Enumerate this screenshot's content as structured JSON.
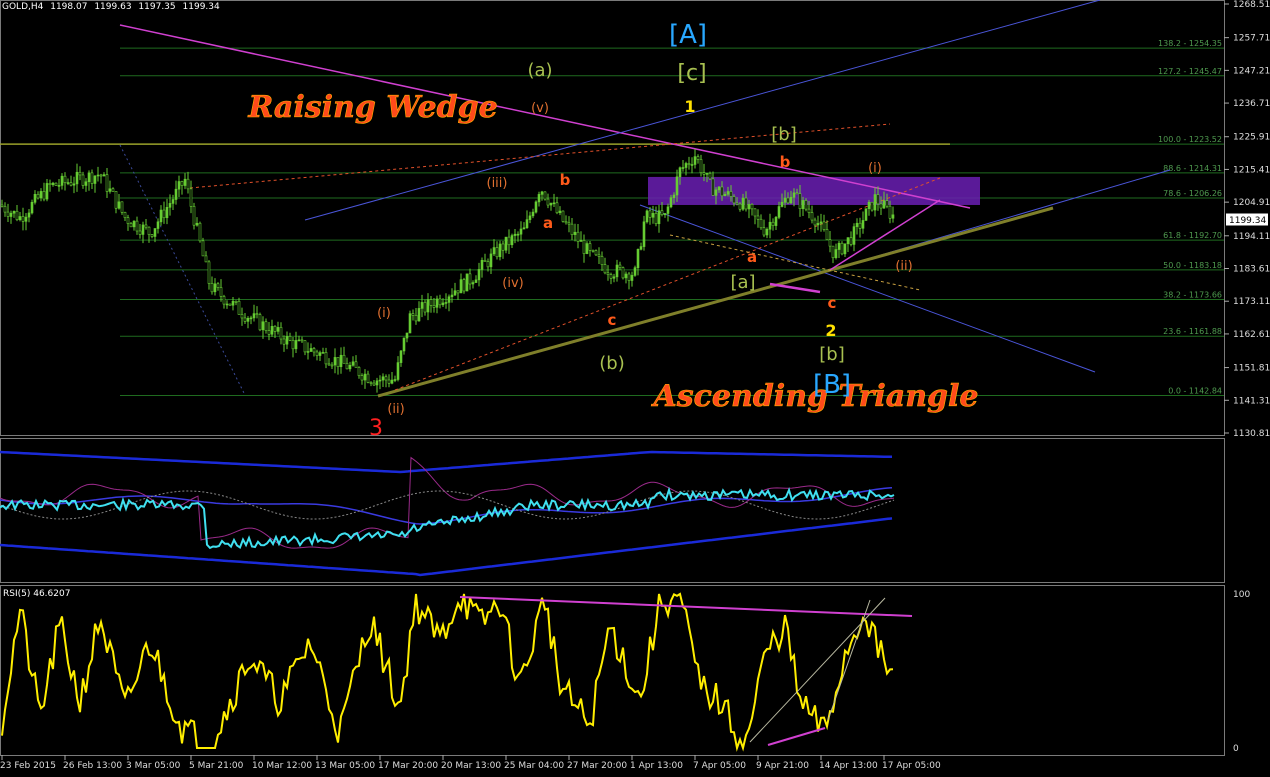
{
  "header": {
    "symbol": "GOLD,H4",
    "open": "1198.07",
    "high": "1199.63",
    "low": "1197.35",
    "close": "1199.34"
  },
  "current_price": "1199.34",
  "rsi_label": "RSI(5) 46.6207",
  "price_axis": [
    "1268.51",
    "1257.71",
    "1247.21",
    "1236.71",
    "1225.91",
    "1215.41",
    "1204.91",
    "1194.11",
    "1183.61",
    "1173.11",
    "1162.61",
    "1151.81",
    "1141.31",
    "1130.81"
  ],
  "fib_levels": [
    {
      "label": "138.2 - 1254.35",
      "price": 1254.35
    },
    {
      "label": "127.2 - 1245.47",
      "price": 1245.47
    },
    {
      "label": "100.0 - 1223.52",
      "price": 1223.52
    },
    {
      "label": "88.6 - 1214.31",
      "price": 1214.31
    },
    {
      "label": "78.6 - 1206.26",
      "price": 1206.26
    },
    {
      "label": "61.8 - 1192.70",
      "price": 1192.7
    },
    {
      "label": "50.0 - 1183.18",
      "price": 1183.18
    },
    {
      "label": "38.2 - 1173.66",
      "price": 1173.66
    },
    {
      "label": "23.6 - 1161.88",
      "price": 1161.88
    },
    {
      "label": "0.0 - 1142.84",
      "price": 1142.84
    }
  ],
  "time_axis": [
    "23 Feb 2015",
    "26 Feb 13:00",
    "3 Mar 05:00",
    "5 Mar 21:00",
    "10 Mar 12:00",
    "13 Mar 05:00",
    "17 Mar 20:00",
    "20 Mar 13:00",
    "25 Mar 04:00",
    "27 Mar 20:00",
    "1 Apr 13:00",
    "7 Apr 05:00",
    "9 Apr 21:00",
    "14 Apr 13:00",
    "17 Apr 05:00"
  ],
  "rsi_axis": [
    "100",
    "0"
  ],
  "annotations": {
    "raising_wedge": "Raising Wedge",
    "ascending_triangle": "Ascending Triangle",
    "A_big": "[A]",
    "B_big": "[B]",
    "c_bracket": "[c]",
    "b_bracket_top": "[b]",
    "a_bracket": "[a]",
    "b_bracket_bottom": "[b]",
    "a_paren": "(a)",
    "b_paren": "(b)",
    "one": "1",
    "two": "2",
    "three": "3",
    "i_paren_left": "(i)",
    "ii_paren_left": "(ii)",
    "iii_paren": "(iii)",
    "iv_paren": "(iv)",
    "v_paren": "(v)",
    "i_paren_right": "(i)",
    "ii_paren_right": "(ii)",
    "a_left": "a",
    "b_left": "b",
    "c_left": "c",
    "a_right": "a",
    "b_right": "b",
    "c_right": "c"
  },
  "colors": {
    "background": "#000000",
    "bull_candle": "#66cc33",
    "fib_line": "#1f6b1f",
    "wedge_magenta": "#d040d0",
    "blue_channel": "#4a55d8",
    "olive_trend": "#7f7f2a",
    "purple_box": "#6a1fb3",
    "rsi_line": "#ffee00",
    "bands_outer": "#1a2ad8",
    "mid_cyan": "#40e0f0"
  },
  "chart_data": {
    "type": "candlestick",
    "title": "GOLD,H4",
    "ylim": [
      1130.81,
      1268.51
    ],
    "series": [
      {
        "name": "GOLD,H4 close (approx.)",
        "x": [
          "23 Feb 2015",
          "26 Feb 13:00",
          "3 Mar 05:00",
          "5 Mar 21:00",
          "10 Mar 12:00",
          "13 Mar 05:00",
          "17 Mar 20:00",
          "20 Mar 13:00",
          "25 Mar 04:00",
          "27 Mar 20:00",
          "1 Apr 13:00",
          "7 Apr 05:00",
          "9 Apr 21:00",
          "14 Apr 13:00",
          "17 Apr 05:00"
        ],
        "values": [
          1204,
          1213,
          1198,
          1168,
          1158,
          1152,
          1168,
          1189,
          1205,
          1185,
          1208,
          1202,
          1193,
          1197,
          1199
        ]
      }
    ],
    "rsi": {
      "name": "RSI(5)",
      "last": 46.6207,
      "ylim": [
        0,
        100
      ]
    }
  }
}
